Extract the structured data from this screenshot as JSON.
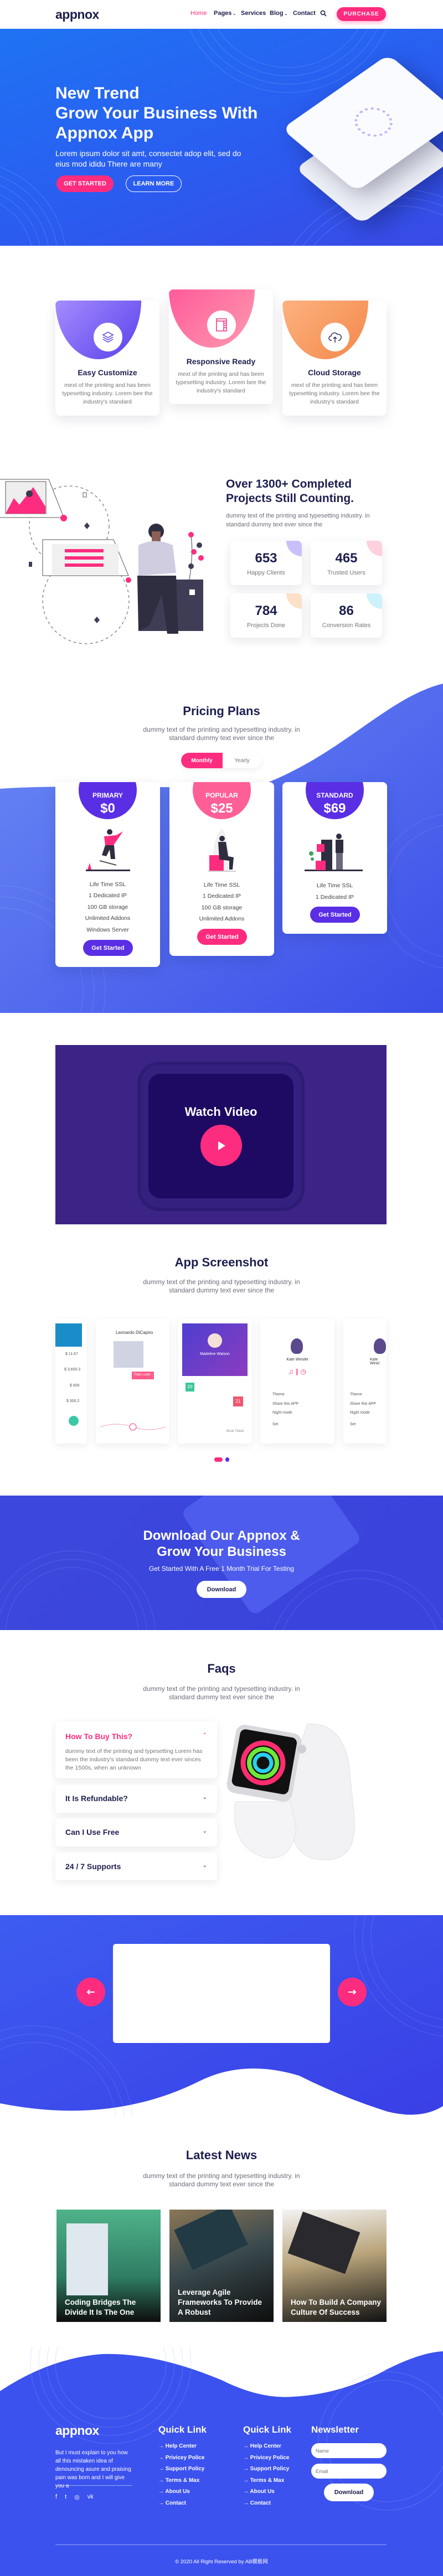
{
  "colors": {
    "accent": "#fe2c7f",
    "primary_blue": "#3b4ee8",
    "purple": "#5a2ee5",
    "dark_text": "#1d1e4e"
  },
  "nav": {
    "logo": "appnox",
    "items": [
      {
        "label": "Home",
        "active": true
      },
      {
        "label": "Pages",
        "dropdown": true
      },
      {
        "label": "Services"
      },
      {
        "label": "Blog",
        "dropdown": true
      },
      {
        "label": "Contact"
      }
    ],
    "search_icon": "search-icon",
    "purchase": "PURCHASE"
  },
  "hero": {
    "title_line1": "New Trend",
    "title_line2": "Grow Your Business With",
    "title_line3": "Appnox App",
    "text": "Lorem ipsum dolor sit amt, consectet adop elit, sed do eius mod ididu There are many",
    "get_started": "GET STARTED",
    "learn_more": "LEARN MORE"
  },
  "features": [
    {
      "title": "Easy Customize",
      "text": "mext of the printing and has been typesetting industry. Lorem bee the industry's standard",
      "icon": "layers-icon",
      "color": "#6a4cf0"
    },
    {
      "title": "Responsive Ready",
      "text": "mext of the printing and has been typesetting industry. Lorem bee the industry's standard",
      "icon": "layout-icon",
      "color": "#fe5f97"
    },
    {
      "title": "Cloud Storage",
      "text": "mext of the printing and has been typesetting industry. Lorem bee the industry's standard",
      "icon": "cloud-upload-icon",
      "color": "#f6955a"
    }
  ],
  "stats": {
    "title": "Over 1300+ Completed Projects Still Counting.",
    "text": "dummy text of the printing and typesetting industry. in standard dummy text ever since the",
    "items": [
      {
        "value": "653",
        "label": "Happy Clients",
        "color": "#c9c0fb"
      },
      {
        "value": "465",
        "label": "Trusted Users",
        "color": "#ffd0dd"
      },
      {
        "value": "784",
        "label": "Projects Done",
        "color": "#fde0c8"
      },
      {
        "value": "86",
        "label": "Conversion Rates",
        "color": "#cdf2fb"
      }
    ]
  },
  "pricing": {
    "title": "Pricing Plans",
    "text": "dummy text of the printing and typesetting industry. in standard dummy text ever since the",
    "toggle": {
      "monthly": "Monthly",
      "yearly": "Yearly",
      "selected": "Monthly"
    },
    "plans": [
      {
        "name": "PRIMARY",
        "price": "$0",
        "features": [
          "Life Time SSL",
          "1 Dedicated IP",
          "100 GB storage",
          "Unlimited Addons",
          "Windows Server"
        ],
        "button": "Get Started",
        "color": "#5a2ee5"
      },
      {
        "name": "POPULAR",
        "price": "$25",
        "features": [
          "Life Time SSL",
          "1 Dedicated IP",
          "100 GB storage",
          "Unlimited Addons"
        ],
        "button": "Get Started",
        "color": "#fe2c7f"
      },
      {
        "name": "STANDARD",
        "price": "$69",
        "features": [
          "Life Time SSL",
          "1 Dedicated IP"
        ],
        "button": "Get Started",
        "color": "#5a2ee5"
      }
    ]
  },
  "video": {
    "title": "Watch Video",
    "play_icon": "play-icon"
  },
  "screenshots": {
    "title": "App Screenshot",
    "text": "dummy text of the printing and typesetting industry. in standard dummy text ever since the",
    "screen1": {
      "amounts": [
        "$ 11.67",
        "$ 3,600.3",
        "$ 600",
        "$ 300.2"
      ]
    },
    "screen2": {
      "name": "Leonardo DiCaprio",
      "bubble": "That's cute!"
    },
    "screen3": {
      "name": "Madeline Watson",
      "day1": "20",
      "day2": "21",
      "link": "Book Ticket"
    },
    "screen4": {
      "name": "Kate Winslet",
      "menu": [
        "Theme",
        "Share this APP",
        "Night mode",
        "Set"
      ]
    },
    "screen5": {
      "name": "Kate Winsl",
      "menu": [
        "Theme",
        "Share this APP",
        "Night mode",
        "Set"
      ]
    },
    "active_dot": 0,
    "dots": 2
  },
  "download": {
    "title_line1": "Download Our Appnox &",
    "title_line2": "Grow Your Business",
    "text": "Get Started With A Free 1 Month Trial For Testing",
    "button": "Download"
  },
  "faq": {
    "title": "Faqs",
    "text": "dummy text of the printing and typesetting industry. in standard dummy text ever since the",
    "items": [
      {
        "q": "How To Buy This?",
        "a": "dummy text of the printing and typesetting Lorem has been the industry's standard dummy text ever sinces the 1500s, when an unknown",
        "open": true
      },
      {
        "q": "It Is Refundable?",
        "open": false
      },
      {
        "q": "Can I Use Free",
        "open": false
      },
      {
        "q": "24 / 7 Supports",
        "open": false
      }
    ]
  },
  "slider": {
    "prev_icon": "arrow-left-icon",
    "next_icon": "arrow-right-icon"
  },
  "news": {
    "title": "Latest News",
    "text": "dummy text of the printing and typesetting industry. in standard dummy text ever since the",
    "items": [
      {
        "title": "Coding Bridges The Divide It Is The One"
      },
      {
        "title": "Leverage Agile Frameworks To Provide A Robust"
      },
      {
        "title": "How To Build A Company Culture Of Success"
      }
    ]
  },
  "footer": {
    "logo": "appnox",
    "about": "But I must explain to you how all this mistaken idea of denouncing asure and praising pain was born and I will give you a",
    "social": [
      "facebook-icon",
      "twitter-icon",
      "instagram-icon",
      "vk-icon"
    ],
    "col1": {
      "title": "Quick Link",
      "links": [
        "Help Center",
        "Privicey Police",
        "Support Policy",
        "Terms & Max",
        "About Us",
        "Contact"
      ]
    },
    "col2": {
      "title": "Quick Link",
      "links": [
        "Help Center",
        "Privicey Police",
        "Support Policy",
        "Terms & Max",
        "About Us",
        "Contact"
      ]
    },
    "newsletter": {
      "title": "Newsletter",
      "name_placeholder": "Name",
      "email_placeholder": "Email",
      "button": "Download"
    },
    "copyright": "© 2020 All Right Reserved by AB模板网"
  }
}
